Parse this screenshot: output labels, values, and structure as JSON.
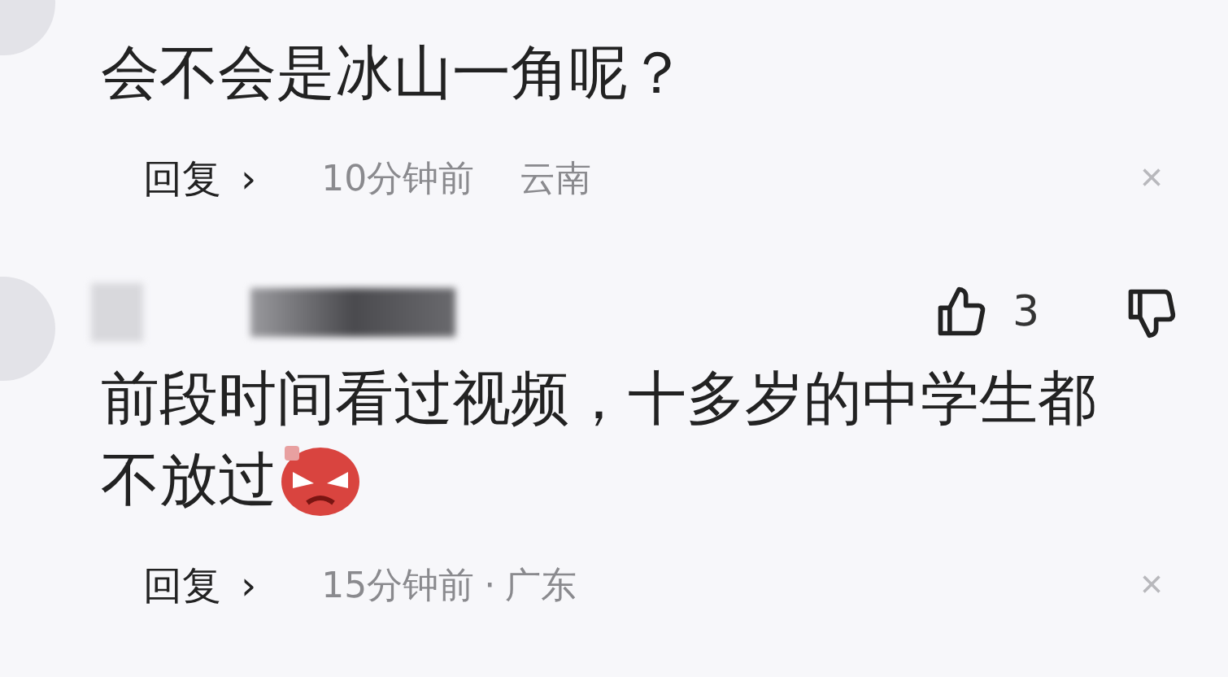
{
  "comments": [
    {
      "lines": [
        "会不会是冰山一角呢？"
      ],
      "reply": "回复",
      "chevron": "›",
      "time": "10分钟前",
      "location": "云南",
      "close": "×"
    },
    {
      "author_redacted": true,
      "likes": "3",
      "lines": [
        "前段时间看过视频，十多岁的中学生都",
        "不放过"
      ],
      "emoji": {
        "kind": "angry"
      },
      "reply": "回复",
      "chevron": "›",
      "time": "15分钟前",
      "location": "广东",
      "separator": "·",
      "close": "×"
    }
  ]
}
